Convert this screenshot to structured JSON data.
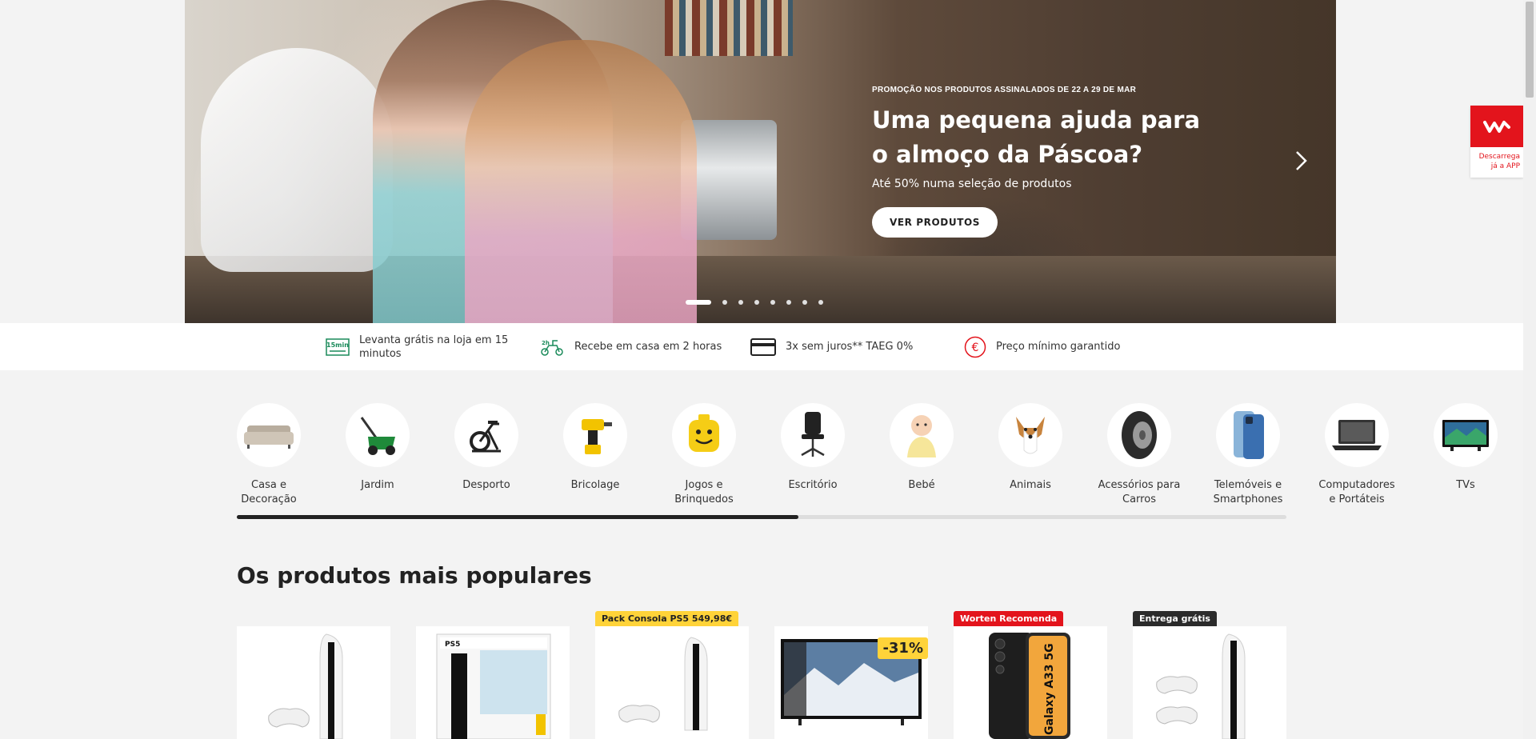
{
  "hero": {
    "promo": "PROMOÇÃO NOS PRODUTOS ASSINALADOS DE 22 A 29 DE MAR",
    "title": "Uma pequena ajuda para o almoço da Páscoa?",
    "subtitle": "Até 50% numa seleção de produtos",
    "button": "VER PRODUTOS",
    "next_icon": "chevron-right-icon",
    "slides_count": 8,
    "active_slide": 1
  },
  "app_download": {
    "label_line1": "Descarrega",
    "label_line2": "já a APP",
    "brand_color": "#e3141c"
  },
  "services": [
    {
      "icon": "15-min-pickup-icon",
      "text_line1": "Levanta grátis na loja em 15",
      "text_line2": "minutos"
    },
    {
      "icon": "2h-delivery-scooter-icon",
      "text_line1": "Recebe em casa em 2 horas",
      "text_line2": ""
    },
    {
      "icon": "credit-card-icon",
      "text_line1": "3x sem juros** TAEG 0%",
      "text_line2": ""
    },
    {
      "icon": "euro-icon",
      "text_line1": "Preço mínimo garantido",
      "text_line2": ""
    }
  ],
  "categories": [
    {
      "line1": "Casa e",
      "line2": "Decoração"
    },
    {
      "line1": "Jardim",
      "line2": ""
    },
    {
      "line1": "Desporto",
      "line2": ""
    },
    {
      "line1": "Bricolage",
      "line2": ""
    },
    {
      "line1": "Jogos e",
      "line2": "Brinquedos"
    },
    {
      "line1": "Escritório",
      "line2": ""
    },
    {
      "line1": "Bebé",
      "line2": ""
    },
    {
      "line1": "Animais",
      "line2": ""
    },
    {
      "line1": "Acessórios para",
      "line2": "Carros"
    },
    {
      "line1": "Telemóveis e",
      "line2": "Smartphones"
    },
    {
      "line1": "Computadores",
      "line2": "e Portáteis"
    },
    {
      "line1": "TVs",
      "line2": ""
    }
  ],
  "categories_scroll_progress": 0.535,
  "popular": {
    "title": "Os produtos mais populares",
    "products": [
      {
        "badge": "",
        "discount": ""
      },
      {
        "badge": "",
        "discount": ""
      },
      {
        "badge": "Pack Consola PS5 549,98€",
        "discount": ""
      },
      {
        "badge": "",
        "discount": "-31%"
      },
      {
        "badge": "Worten Recomenda",
        "discount": ""
      },
      {
        "badge": "Entrega grátis",
        "discount": ""
      }
    ],
    "badge_colors": {
      "yellow": "#ffd339",
      "red": "#e3141c",
      "dark": "#2b2b2b"
    }
  }
}
